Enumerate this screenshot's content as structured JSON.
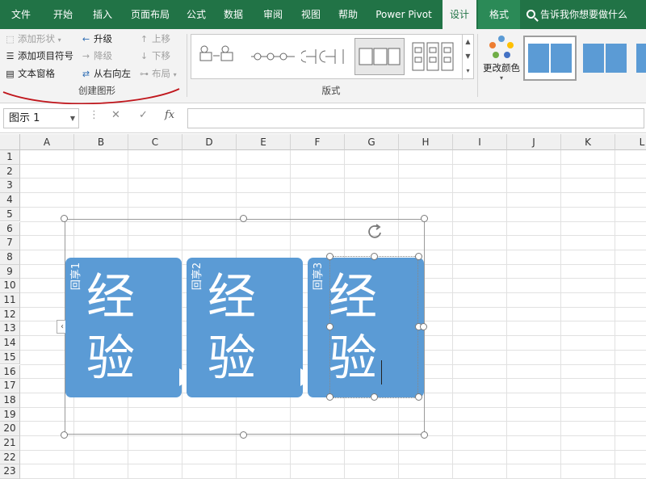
{
  "tabs": [
    "文件",
    "开始",
    "插入",
    "页面布局",
    "公式",
    "数据",
    "审阅",
    "视图",
    "帮助",
    "Power Pivot",
    "设计",
    "格式"
  ],
  "active_tab": "设计",
  "tell_me": "告诉我你想要做什么",
  "ribbon": {
    "create_graphic": {
      "add_shape": "添加形状",
      "add_bullet": "添加项目符号",
      "text_pane": "文本窗格",
      "promote": "升级",
      "demote": "降级",
      "right_to_left": "从右向左",
      "move_up": "上移",
      "move_down": "下移",
      "layout": "布局",
      "group_label": "创建图形"
    },
    "layouts_label": "版式",
    "change_colors": "更改颜色"
  },
  "formula_bar": {
    "name_box": "图示 1",
    "fx": "fx",
    "formula": ""
  },
  "columns": [
    "A",
    "B",
    "C",
    "D",
    "E",
    "F",
    "G",
    "H",
    "I",
    "J",
    "K",
    "L"
  ],
  "rows": [
    "1",
    "2",
    "3",
    "4",
    "5",
    "6",
    "7",
    "8",
    "9",
    "10",
    "11",
    "12",
    "13",
    "14",
    "15",
    "16",
    "17",
    "18",
    "19",
    "20",
    "21",
    "22",
    "23"
  ],
  "smartart": {
    "boxes": [
      {
        "label": "回享1",
        "line1": "经",
        "line2": "验"
      },
      {
        "label": "回享2",
        "line1": "经",
        "line2": "验"
      },
      {
        "label": "回享3",
        "line1": "经",
        "line2": "验"
      }
    ],
    "fill_color": "#5b9bd5"
  },
  "colors": {
    "ribbon_green": "#217346",
    "ribbon_body": "#f3f3f3",
    "annotation_red": "#c0161c"
  }
}
